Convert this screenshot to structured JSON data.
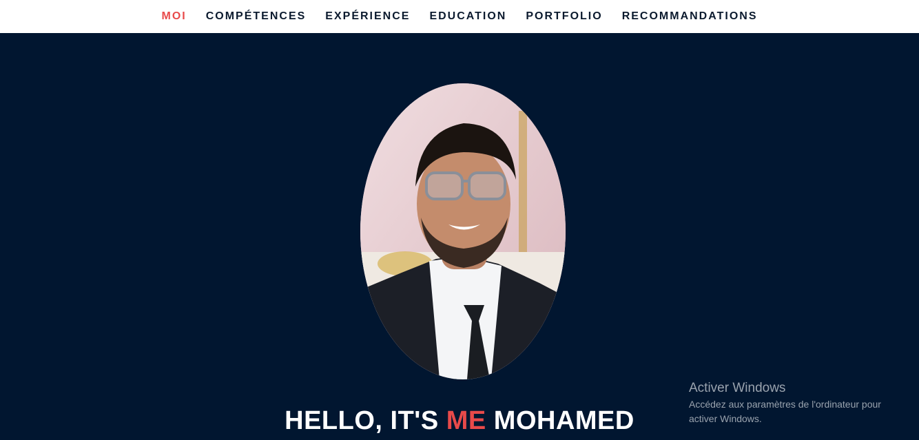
{
  "nav": {
    "items": [
      {
        "label": "MOI",
        "active": true
      },
      {
        "label": "COMPÉTENCES",
        "active": false
      },
      {
        "label": "EXPÉRIENCE",
        "active": false
      },
      {
        "label": "EDUCATION",
        "active": false
      },
      {
        "label": "PORTFOLIO",
        "active": false
      },
      {
        "label": "RECOMMANDATIONS",
        "active": false
      }
    ]
  },
  "hero": {
    "title_prefix": "HELLO, IT'S ",
    "title_accent": "ME",
    "title_suffix": " MOHAMED"
  },
  "watermark": {
    "title": "Activer Windows",
    "body": "Accédez aux paramètres de l'ordinateur pour activer Windows."
  },
  "colors": {
    "accent": "#e84a4a",
    "background": "#011630",
    "nav_text": "#0b1a2e"
  }
}
